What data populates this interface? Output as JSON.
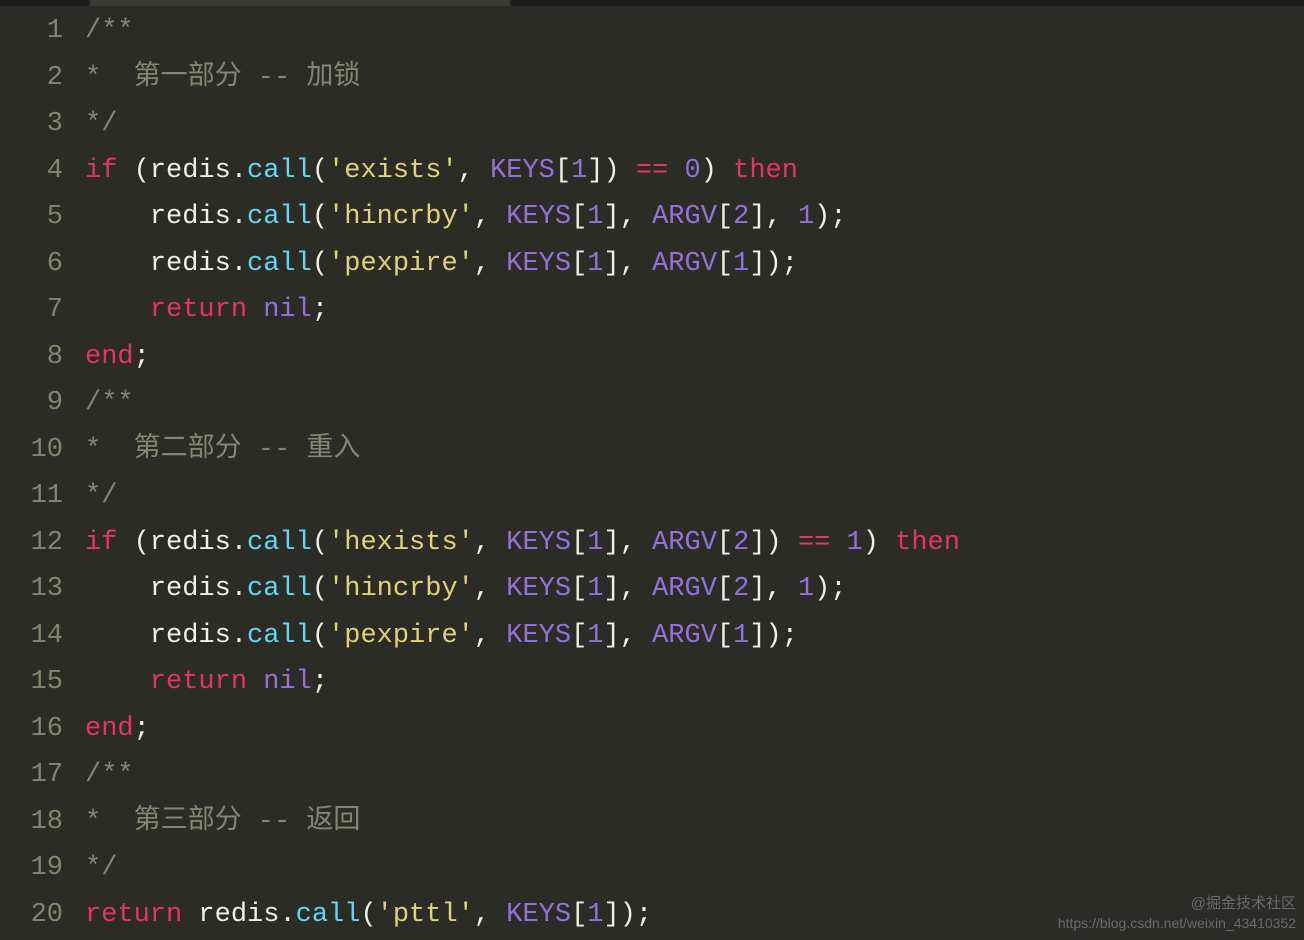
{
  "watermark": {
    "line1": "@掘金技术社区",
    "line2": "https://blog.csdn.net/weixin_43410352"
  },
  "lines": [
    {
      "num": "1",
      "tokens": [
        {
          "t": "comment",
          "v": "/**"
        }
      ]
    },
    {
      "num": "2",
      "tokens": [
        {
          "t": "comment",
          "v": "*  第一部分 -- 加锁"
        }
      ]
    },
    {
      "num": "3",
      "tokens": [
        {
          "t": "comment",
          "v": "*/"
        }
      ]
    },
    {
      "num": "4",
      "tokens": [
        {
          "t": "keyword",
          "v": "if"
        },
        {
          "t": "paren",
          "v": " ("
        },
        {
          "t": "identifier",
          "v": "redis"
        },
        {
          "t": "dot",
          "v": "."
        },
        {
          "t": "method",
          "v": "call"
        },
        {
          "t": "paren",
          "v": "("
        },
        {
          "t": "string",
          "v": "'exists'"
        },
        {
          "t": "paren",
          "v": ", "
        },
        {
          "t": "global",
          "v": "KEYS"
        },
        {
          "t": "paren",
          "v": "["
        },
        {
          "t": "number",
          "v": "1"
        },
        {
          "t": "paren",
          "v": "]) "
        },
        {
          "t": "op",
          "v": "=="
        },
        {
          "t": "paren",
          "v": " "
        },
        {
          "t": "number",
          "v": "0"
        },
        {
          "t": "paren",
          "v": ") "
        },
        {
          "t": "keyword",
          "v": "then"
        }
      ]
    },
    {
      "num": "5",
      "indent": 1,
      "tokens": [
        {
          "t": "pad",
          "v": "    "
        },
        {
          "t": "identifier",
          "v": "redis"
        },
        {
          "t": "dot",
          "v": "."
        },
        {
          "t": "method",
          "v": "call"
        },
        {
          "t": "paren",
          "v": "("
        },
        {
          "t": "string",
          "v": "'hincrby'"
        },
        {
          "t": "paren",
          "v": ", "
        },
        {
          "t": "global",
          "v": "KEYS"
        },
        {
          "t": "paren",
          "v": "["
        },
        {
          "t": "number",
          "v": "1"
        },
        {
          "t": "paren",
          "v": "], "
        },
        {
          "t": "global",
          "v": "ARGV"
        },
        {
          "t": "paren",
          "v": "["
        },
        {
          "t": "number",
          "v": "2"
        },
        {
          "t": "paren",
          "v": "], "
        },
        {
          "t": "number",
          "v": "1"
        },
        {
          "t": "paren",
          "v": ")"
        },
        {
          "t": "semi",
          "v": ";"
        }
      ]
    },
    {
      "num": "6",
      "indent": 1,
      "tokens": [
        {
          "t": "pad",
          "v": "    "
        },
        {
          "t": "identifier",
          "v": "redis"
        },
        {
          "t": "dot",
          "v": "."
        },
        {
          "t": "method",
          "v": "call"
        },
        {
          "t": "paren",
          "v": "("
        },
        {
          "t": "string",
          "v": "'pexpire'"
        },
        {
          "t": "paren",
          "v": ", "
        },
        {
          "t": "global",
          "v": "KEYS"
        },
        {
          "t": "paren",
          "v": "["
        },
        {
          "t": "number",
          "v": "1"
        },
        {
          "t": "paren",
          "v": "], "
        },
        {
          "t": "global",
          "v": "ARGV"
        },
        {
          "t": "paren",
          "v": "["
        },
        {
          "t": "number",
          "v": "1"
        },
        {
          "t": "paren",
          "v": "])"
        },
        {
          "t": "semi",
          "v": ";"
        }
      ]
    },
    {
      "num": "7",
      "indent": 1,
      "tokens": [
        {
          "t": "pad",
          "v": "    "
        },
        {
          "t": "keyword",
          "v": "return"
        },
        {
          "t": "paren",
          "v": " "
        },
        {
          "t": "nil",
          "v": "nil"
        },
        {
          "t": "semi",
          "v": ";"
        }
      ]
    },
    {
      "num": "8",
      "tokens": [
        {
          "t": "keyword",
          "v": "end"
        },
        {
          "t": "semi",
          "v": ";"
        }
      ]
    },
    {
      "num": "9",
      "tokens": [
        {
          "t": "comment",
          "v": "/**"
        }
      ]
    },
    {
      "num": "10",
      "tokens": [
        {
          "t": "comment",
          "v": "*  第二部分 -- 重入"
        }
      ]
    },
    {
      "num": "11",
      "tokens": [
        {
          "t": "comment",
          "v": "*/"
        }
      ]
    },
    {
      "num": "12",
      "tokens": [
        {
          "t": "keyword",
          "v": "if"
        },
        {
          "t": "paren",
          "v": " ("
        },
        {
          "t": "identifier",
          "v": "redis"
        },
        {
          "t": "dot",
          "v": "."
        },
        {
          "t": "method",
          "v": "call"
        },
        {
          "t": "paren",
          "v": "("
        },
        {
          "t": "string",
          "v": "'hexists'"
        },
        {
          "t": "paren",
          "v": ", "
        },
        {
          "t": "global",
          "v": "KEYS"
        },
        {
          "t": "paren",
          "v": "["
        },
        {
          "t": "number",
          "v": "1"
        },
        {
          "t": "paren",
          "v": "], "
        },
        {
          "t": "global",
          "v": "ARGV"
        },
        {
          "t": "paren",
          "v": "["
        },
        {
          "t": "number",
          "v": "2"
        },
        {
          "t": "paren",
          "v": "]) "
        },
        {
          "t": "op",
          "v": "=="
        },
        {
          "t": "paren",
          "v": " "
        },
        {
          "t": "number",
          "v": "1"
        },
        {
          "t": "paren",
          "v": ") "
        },
        {
          "t": "keyword",
          "v": "then"
        }
      ]
    },
    {
      "num": "13",
      "indent": 1,
      "tokens": [
        {
          "t": "pad",
          "v": "    "
        },
        {
          "t": "identifier",
          "v": "redis"
        },
        {
          "t": "dot",
          "v": "."
        },
        {
          "t": "method",
          "v": "call"
        },
        {
          "t": "paren",
          "v": "("
        },
        {
          "t": "string",
          "v": "'hincrby'"
        },
        {
          "t": "paren",
          "v": ", "
        },
        {
          "t": "global",
          "v": "KEYS"
        },
        {
          "t": "paren",
          "v": "["
        },
        {
          "t": "number",
          "v": "1"
        },
        {
          "t": "paren",
          "v": "], "
        },
        {
          "t": "global",
          "v": "ARGV"
        },
        {
          "t": "paren",
          "v": "["
        },
        {
          "t": "number",
          "v": "2"
        },
        {
          "t": "paren",
          "v": "], "
        },
        {
          "t": "number",
          "v": "1"
        },
        {
          "t": "paren",
          "v": ")"
        },
        {
          "t": "semi",
          "v": ";"
        }
      ]
    },
    {
      "num": "14",
      "indent": 1,
      "tokens": [
        {
          "t": "pad",
          "v": "    "
        },
        {
          "t": "identifier",
          "v": "redis"
        },
        {
          "t": "dot",
          "v": "."
        },
        {
          "t": "method",
          "v": "call"
        },
        {
          "t": "paren",
          "v": "("
        },
        {
          "t": "string",
          "v": "'pexpire'"
        },
        {
          "t": "paren",
          "v": ", "
        },
        {
          "t": "global",
          "v": "KEYS"
        },
        {
          "t": "paren",
          "v": "["
        },
        {
          "t": "number",
          "v": "1"
        },
        {
          "t": "paren",
          "v": "], "
        },
        {
          "t": "global",
          "v": "ARGV"
        },
        {
          "t": "paren",
          "v": "["
        },
        {
          "t": "number",
          "v": "1"
        },
        {
          "t": "paren",
          "v": "])"
        },
        {
          "t": "semi",
          "v": ";"
        }
      ]
    },
    {
      "num": "15",
      "indent": 1,
      "tokens": [
        {
          "t": "pad",
          "v": "    "
        },
        {
          "t": "keyword",
          "v": "return"
        },
        {
          "t": "paren",
          "v": " "
        },
        {
          "t": "nil",
          "v": "nil"
        },
        {
          "t": "semi",
          "v": ";"
        }
      ]
    },
    {
      "num": "16",
      "tokens": [
        {
          "t": "keyword",
          "v": "end"
        },
        {
          "t": "semi",
          "v": ";"
        }
      ]
    },
    {
      "num": "17",
      "tokens": [
        {
          "t": "comment",
          "v": "/**"
        }
      ]
    },
    {
      "num": "18",
      "tokens": [
        {
          "t": "comment",
          "v": "*  第三部分 -- 返回"
        }
      ]
    },
    {
      "num": "19",
      "tokens": [
        {
          "t": "comment",
          "v": "*/"
        }
      ]
    },
    {
      "num": "20",
      "tokens": [
        {
          "t": "keyword",
          "v": "return"
        },
        {
          "t": "paren",
          "v": " "
        },
        {
          "t": "identifier",
          "v": "redis"
        },
        {
          "t": "dot",
          "v": "."
        },
        {
          "t": "method",
          "v": "call"
        },
        {
          "t": "paren",
          "v": "("
        },
        {
          "t": "string",
          "v": "'pttl'"
        },
        {
          "t": "paren",
          "v": ", "
        },
        {
          "t": "global",
          "v": "KEYS"
        },
        {
          "t": "paren",
          "v": "["
        },
        {
          "t": "number",
          "v": "1"
        },
        {
          "t": "paren",
          "v": "])"
        },
        {
          "t": "semi",
          "v": ";"
        }
      ]
    }
  ]
}
